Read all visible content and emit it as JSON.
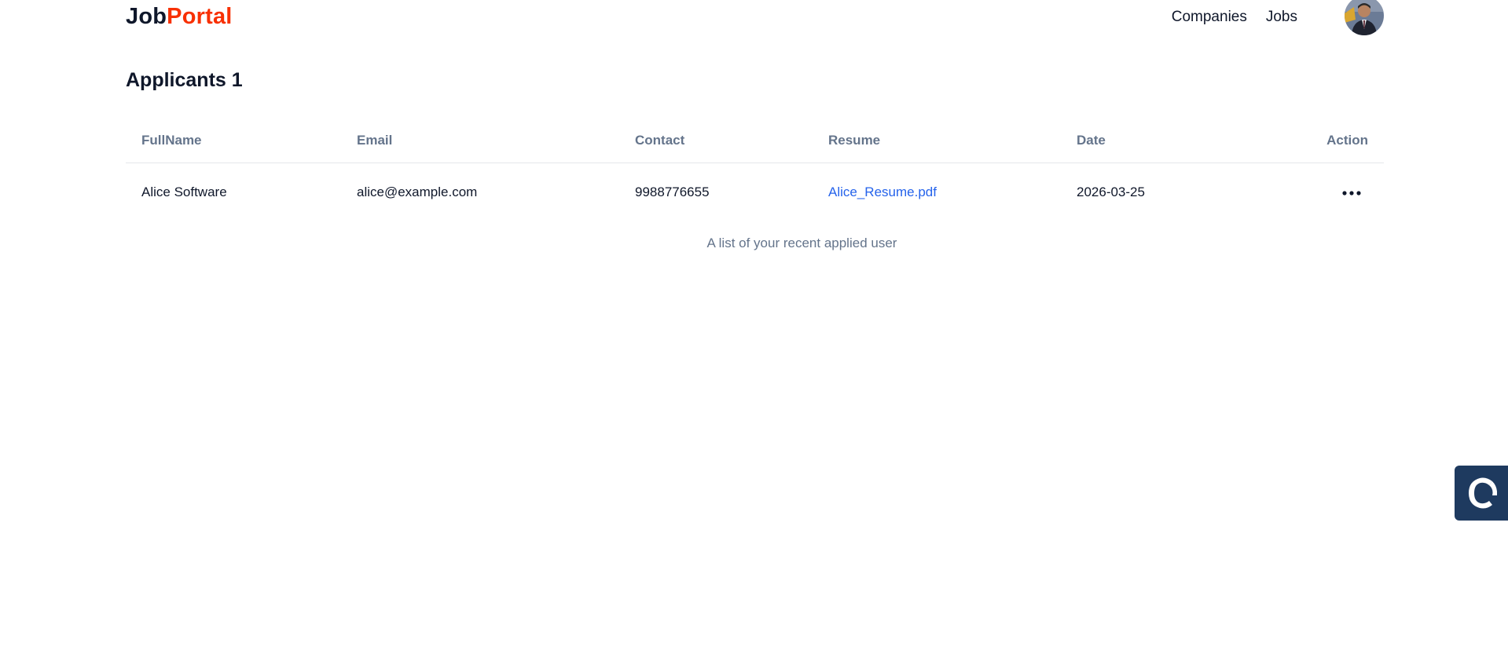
{
  "brand": {
    "name_prefix": "Job",
    "name_suffix": "Portal",
    "accent_color": "#f83002"
  },
  "nav": {
    "links": [
      "Companies",
      "Jobs"
    ],
    "avatar_icon": "user-avatar"
  },
  "page": {
    "title": "Applicants 1"
  },
  "table": {
    "columns": [
      "FullName",
      "Email",
      "Contact",
      "Resume",
      "Date",
      "Action"
    ],
    "rows": [
      {
        "fullname": "Alice Software",
        "email": "alice@example.com",
        "contact": "9988776655",
        "resume": "Alice_Resume.pdf",
        "date": "2026-03-25",
        "action_icon": "more-horizontal-icon"
      }
    ],
    "caption": "A list of your recent applied user",
    "link_color": "#2563eb"
  },
  "widget": {
    "icon": "c-logo-icon",
    "color": "#1e3a5f"
  }
}
